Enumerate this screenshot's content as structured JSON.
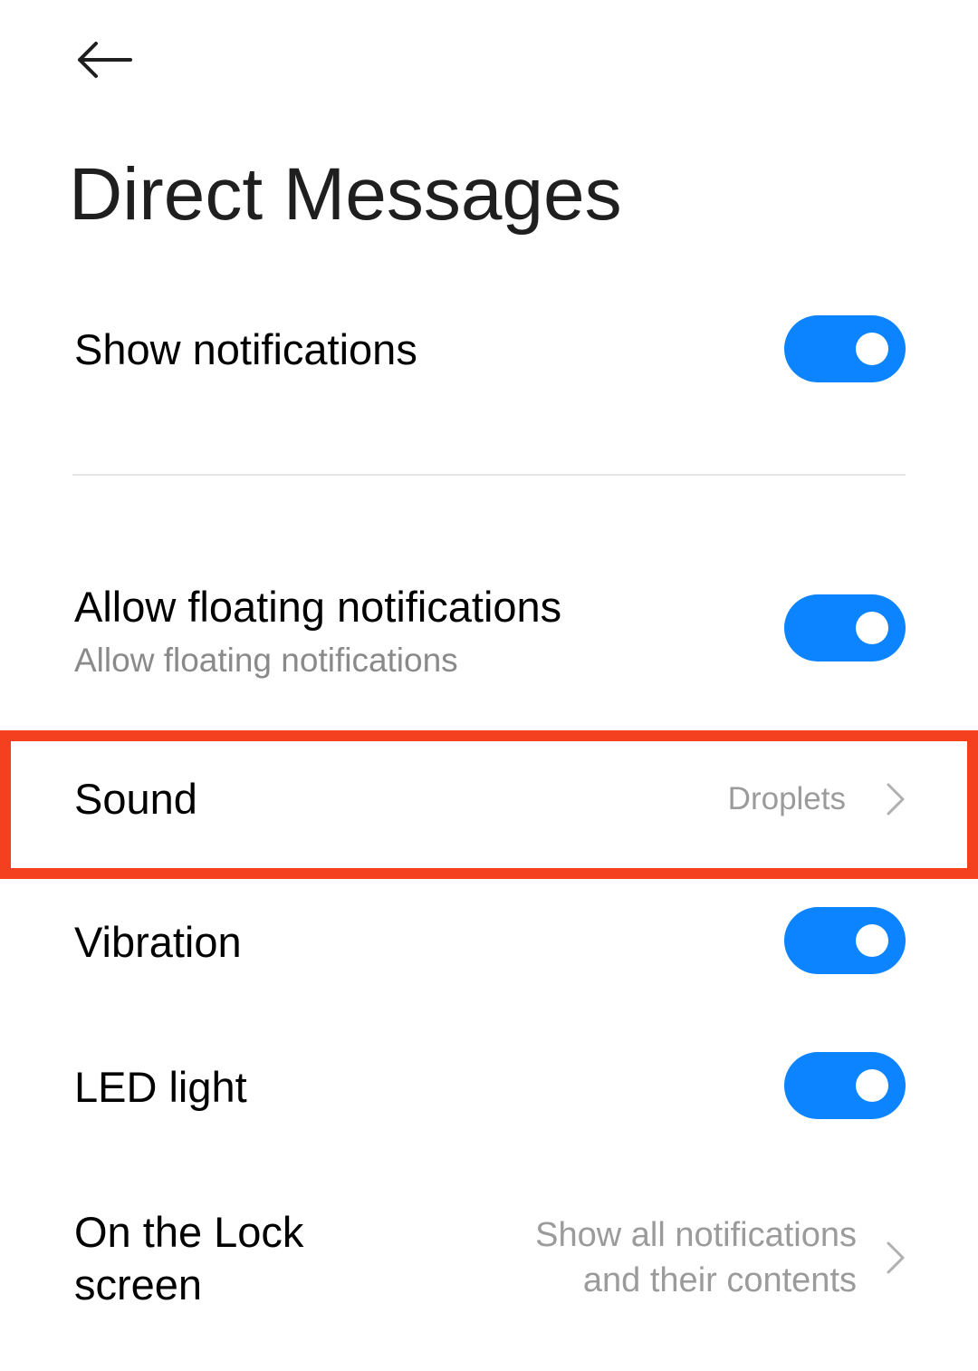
{
  "header": {
    "back_icon": "arrow-left-icon",
    "title": "Direct Messages"
  },
  "accent_color": "#0d84ff",
  "highlight_color": "#f4401f",
  "settings": {
    "show_notifications": {
      "label": "Show notifications",
      "enabled": true
    },
    "floating": {
      "label": "Allow floating notifications",
      "sublabel": "Allow floating notifications",
      "enabled": true
    },
    "sound": {
      "label": "Sound",
      "value": "Droplets",
      "chevron_icon": "chevron-right-icon"
    },
    "vibration": {
      "label": "Vibration",
      "enabled": true
    },
    "led": {
      "label": "LED light",
      "enabled": true
    },
    "lock_screen": {
      "label_line1": "On the Lock",
      "label_line2": "screen",
      "value_line1": "Show all notifications",
      "value_line2": "and their contents",
      "chevron_icon": "chevron-right-icon"
    }
  }
}
